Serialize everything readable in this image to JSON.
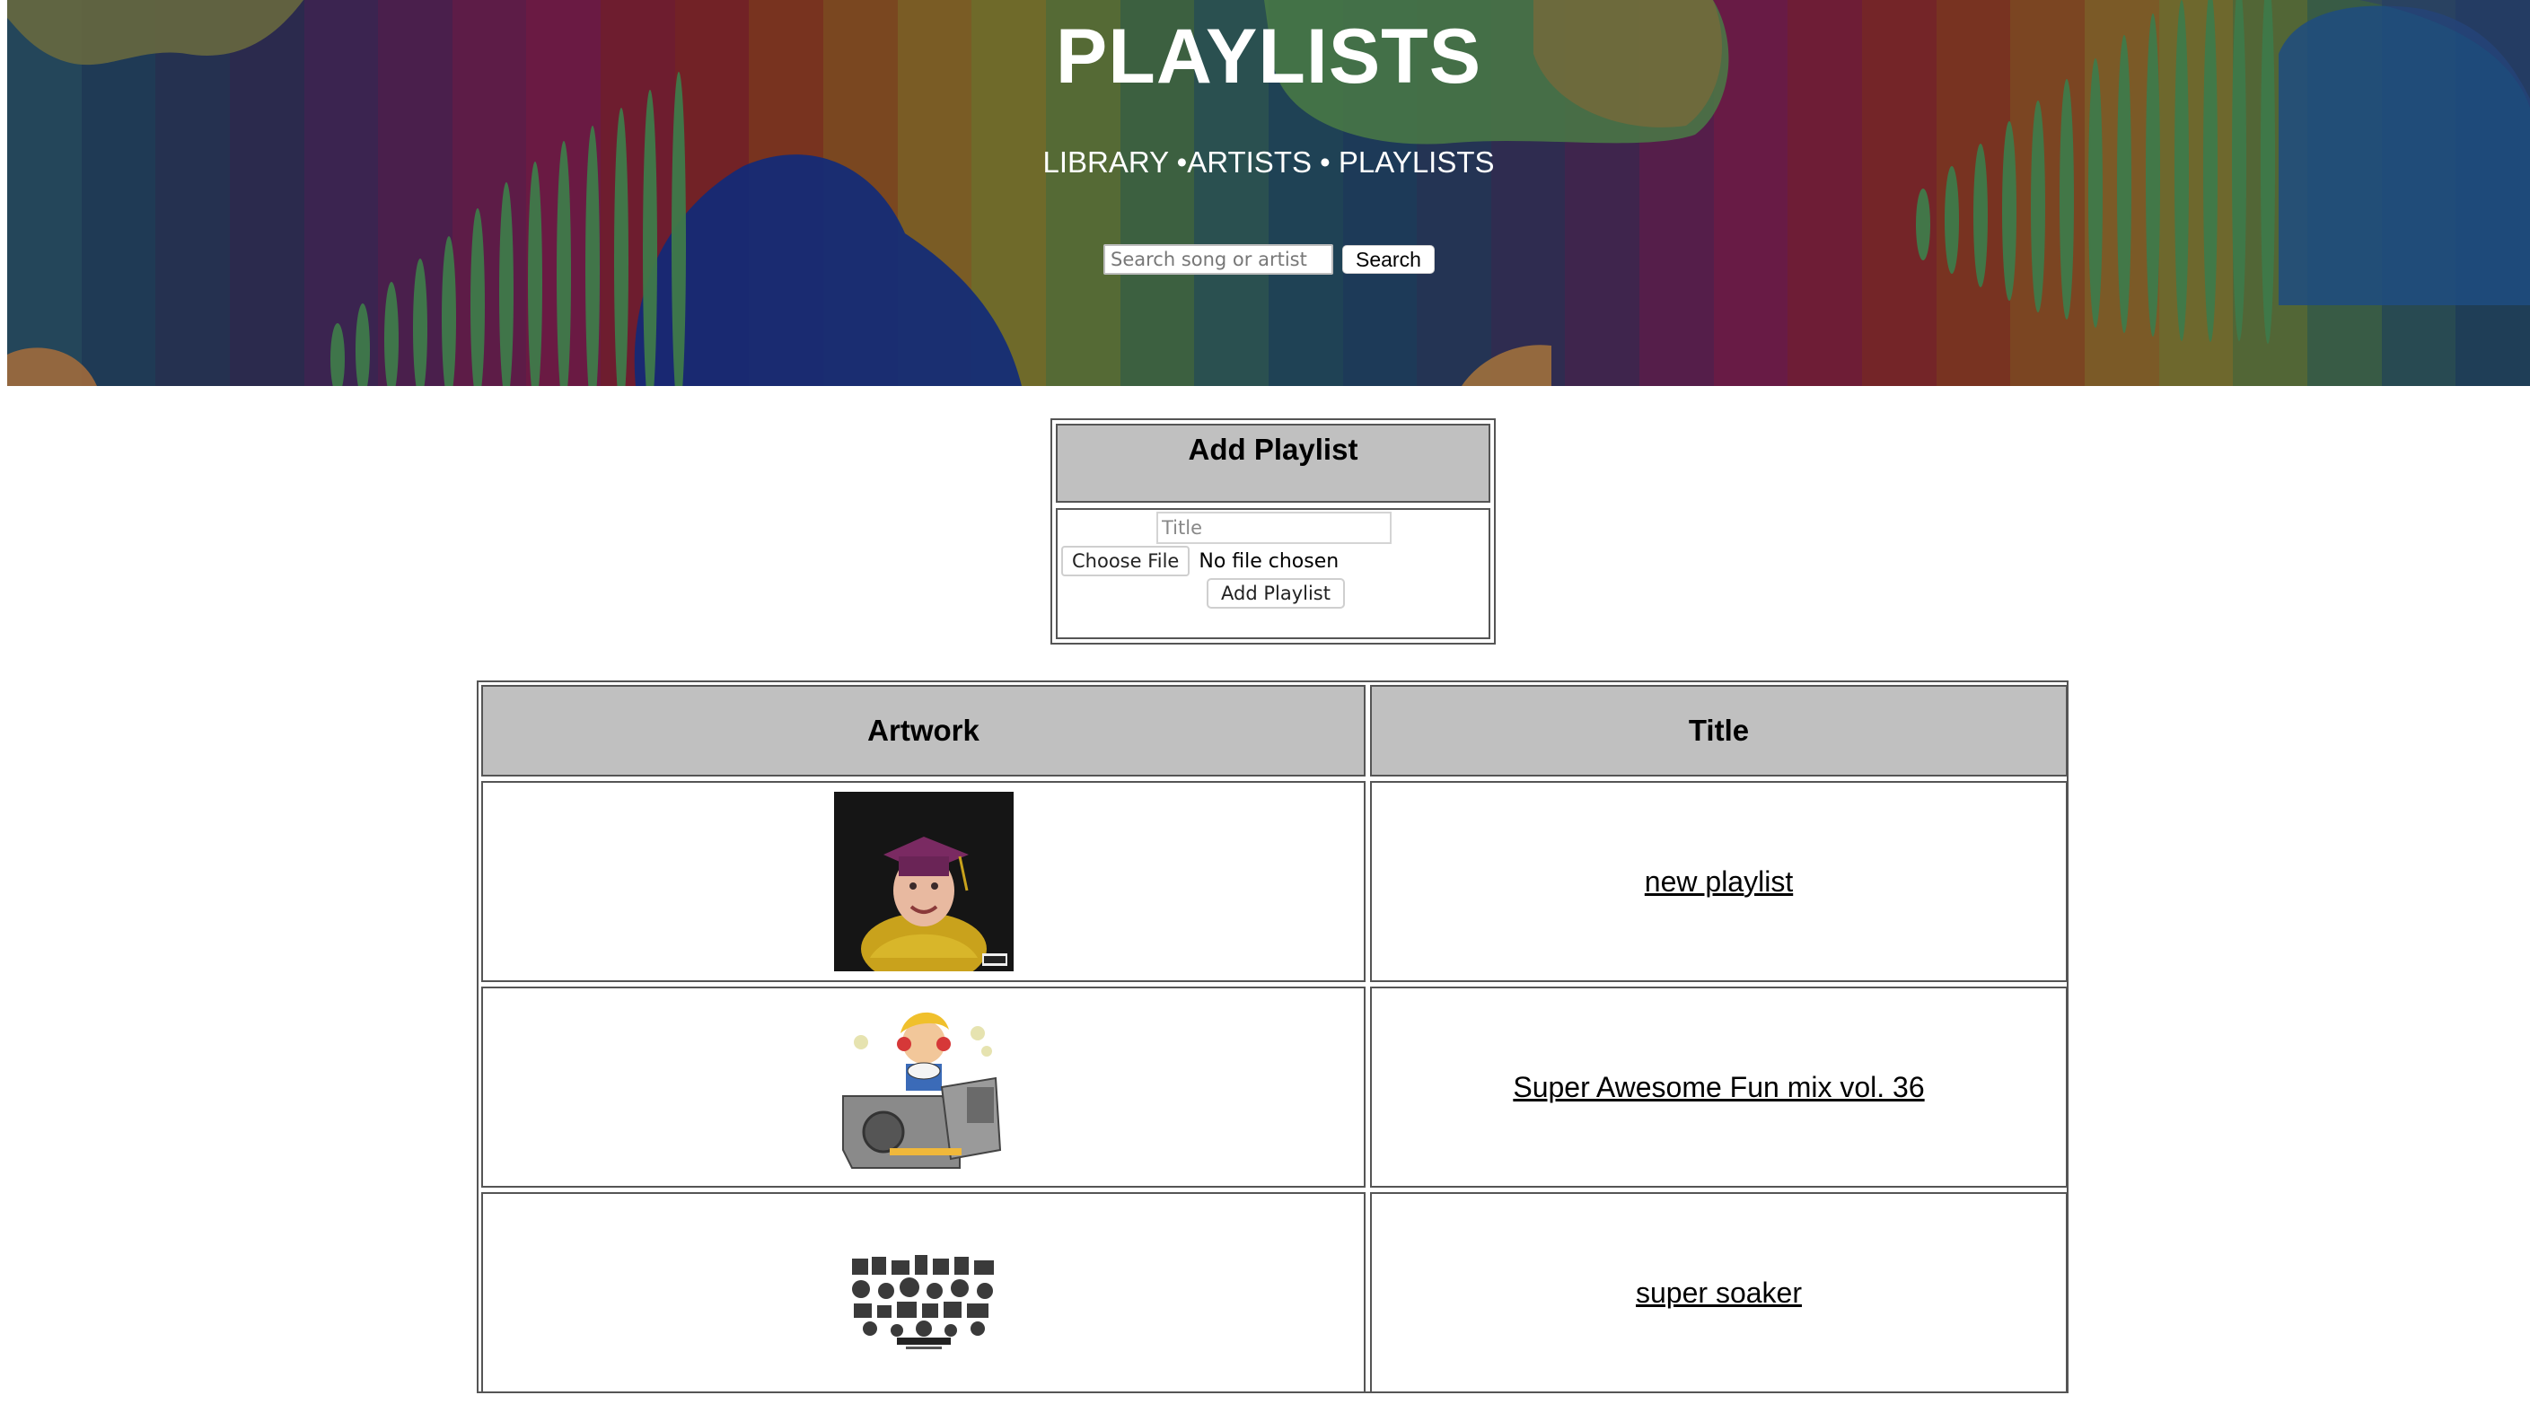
{
  "header": {
    "title": "PLAYLISTS",
    "nav": {
      "library": "LIBRARY",
      "sep1": " •",
      "artists": "ARTISTS",
      "sep2": " • ",
      "playlists": "PLAYLISTS"
    },
    "search": {
      "placeholder": "Search song or artist",
      "button_label": "Search"
    }
  },
  "add_form": {
    "heading": "Add Playlist",
    "title_placeholder": "Title",
    "file_button_label": "Choose File",
    "file_status": "No file chosen",
    "submit_label": "Add Playlist"
  },
  "table": {
    "headers": {
      "artwork": "Artwork",
      "title": "Title"
    },
    "rows": [
      {
        "title": "new playlist",
        "artwork_icon": "graduation-photo-artwork"
      },
      {
        "title": "Super Awesome Fun mix vol. 36",
        "artwork_icon": "cartoon-dj-artwork"
      },
      {
        "title": "super soaker",
        "artwork_icon": "collage-artwork"
      }
    ]
  },
  "colors": {
    "header_cell_bg": "#c0c0c0",
    "border": "#555555"
  }
}
